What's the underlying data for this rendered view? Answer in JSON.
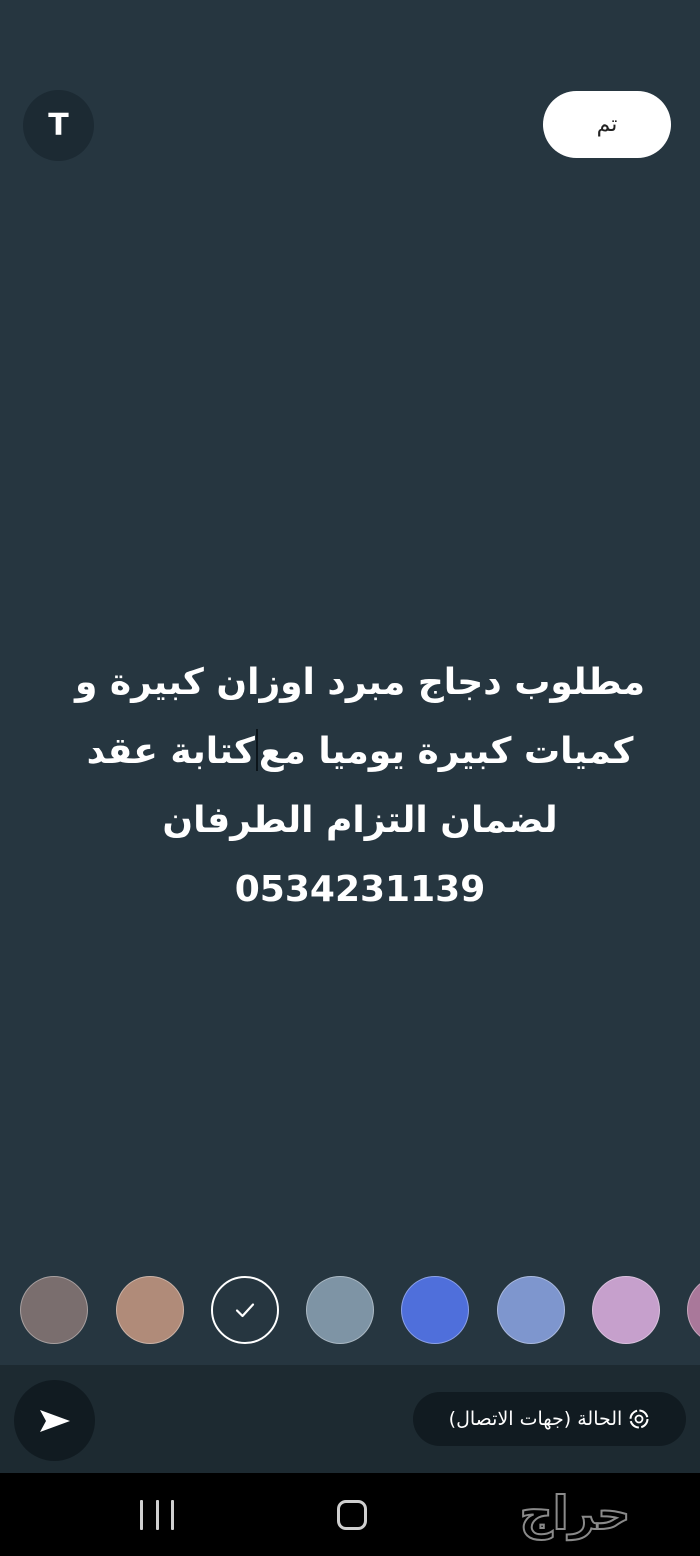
{
  "toolbar": {
    "font_button_label": "T",
    "done_label": "تم"
  },
  "status": {
    "lines_before_caret": "مطلوب دجاج مبرد اوزان كبيرة و",
    "line2_right": "كميات كبيرة يوميا مع",
    "line2_left": "كتابة عقد",
    "line3": "لضمان التزام الطرفان",
    "line4": "0534231139"
  },
  "palette": {
    "colors": [
      "#7a6e6e",
      "#b08b79",
      "#263640",
      "#7e94a5",
      "#4f6fdb",
      "#7e96ce",
      "#c6a0cc",
      "#a9789a"
    ],
    "selected_index": 2
  },
  "audience": {
    "label": "الحالة (جهات الاتصال)",
    "icon": "status-ring-icon"
  },
  "send": {
    "icon": "send-arrow-icon"
  },
  "nav": {
    "recents_icon": "recents-icon",
    "home_icon": "home-icon"
  },
  "watermark": {
    "text": "حراج"
  }
}
